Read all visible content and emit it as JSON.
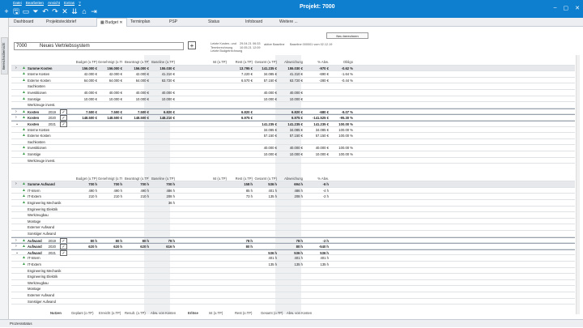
{
  "menu": [
    "Datei",
    "Bearbeiten",
    "Ansicht",
    "Extras",
    "?"
  ],
  "tools": [
    "+",
    "🖫",
    "▭",
    "⏷",
    "↶",
    "↷",
    "✕",
    "⇊",
    "⌂",
    "⇥"
  ],
  "window_title": "Projekt: 7000",
  "tabs": [
    "Dashboard",
    "Projektsteckbrief",
    "Budget",
    "Terminplan",
    "PSP",
    "Status",
    "Infoboard",
    "Weitere ..."
  ],
  "sidebar_label": "Bereichsübersicht",
  "header": {
    "project_id": "7000",
    "project_name": "Neues Vertriebssystem",
    "info_lines": [
      "Letzte Kosten- und Terminrechnung",
      "Letzte Budgetrechnung"
    ],
    "info_dates": [
      "29.04.21",
      "10.05.21"
    ],
    "info_times": [
      "06:33",
      "12:09"
    ],
    "aktive_label": "aktive Baseline",
    "aktive_value": "Baseline 000001 vom 02.12.19",
    "new_button": "Neu berechnen"
  },
  "cost_columns": [
    "Budget (o.TP)",
    "Genehmigt (o.TP)",
    "Beantragt (o.TP)",
    "Baseline (o.TP)",
    "Ist (o.TP)",
    "Rest (o.TP)",
    "Gesamt (o.TP)",
    "Abweichung",
    "% Abw.",
    "Obligo"
  ],
  "effort_columns": [
    "Budget (o.TP)",
    "Genehmigt (o.TP)",
    "Beantragt (o.TP)",
    "Baseline (o.TP)",
    "Ist (o.TP)",
    "Rest (o.TP)",
    "Gesamt (o.TP)",
    "Abweichung",
    "% Abw."
  ],
  "cost_rows": [
    {
      "kind": "sum",
      "label": "Summe Kosten",
      "v": [
        "156.000 €",
        "156.000 €",
        "156.000 €",
        "155.030 €",
        "",
        "13.795 €",
        "141.235 €",
        "155.030 €",
        "-970 €",
        "-0.62 %",
        ""
      ]
    },
    {
      "kind": "item",
      "label": "Interne Kosten",
      "v": [
        "42.000 €",
        "42.000 €",
        "42.000 €",
        "41.310 €",
        "",
        "7.220 €",
        "34.085 €",
        "41.310 €",
        "-690 €",
        "-1.64 %",
        ""
      ]
    },
    {
      "kind": "item",
      "label": "Externe Kosten",
      "v": [
        "64.000 €",
        "64.000 €",
        "64.000 €",
        "63.720 €",
        "",
        "6.570 €",
        "57.150 €",
        "63.720 €",
        "-280 €",
        "-0.44 %",
        ""
      ]
    },
    {
      "kind": "item",
      "label": "Sachkosten",
      "v": [
        "",
        "",
        "",
        "",
        "",
        "",
        "",
        "",
        "",
        "",
        ""
      ]
    },
    {
      "kind": "item",
      "label": "Investitionen",
      "v": [
        "40.000 €",
        "40.000 €",
        "40.000 €",
        "40.000 €",
        "",
        "",
        "40.000 €",
        "40.000 €",
        "",
        "",
        ""
      ]
    },
    {
      "kind": "item",
      "label": "Sonstige",
      "v": [
        "10.000 €",
        "10.000 €",
        "10.000 €",
        "10.000 €",
        "",
        "",
        "10.000 €",
        "10.000 €",
        "",
        "",
        ""
      ]
    },
    {
      "kind": "item",
      "label": "Werkzeuge invest.",
      "v": [
        "",
        "",
        "",
        "",
        "",
        "",
        "",
        "",
        "",
        "",
        ""
      ]
    },
    {
      "kind": "year",
      "label": "Kosten",
      "year": "2019",
      "v": [
        "7.500 €",
        "7.500 €",
        "7.500 €",
        "6.820 €",
        "",
        "6.820 €",
        "",
        "6.820 €",
        "-680 €",
        "-9.07 %",
        ""
      ]
    },
    {
      "kind": "year",
      "label": "Kosten",
      "year": "2020",
      "v": [
        "148.500 €",
        "148.500 €",
        "148.500 €",
        "148.210 €",
        "",
        "6.975 €",
        "",
        "6.975 €",
        "-141.525 €",
        "-95.30 %",
        ""
      ]
    },
    {
      "kind": "year",
      "label": "Kosten",
      "year": "2021",
      "v": [
        "",
        "",
        "",
        "",
        "",
        "",
        "141.235 €",
        "141.235 €",
        "141.235 €",
        "100.00 %",
        ""
      ]
    },
    {
      "kind": "item",
      "label": "Interne Kosten",
      "v": [
        "",
        "",
        "",
        "",
        "",
        "",
        "34.085 €",
        "34.085 €",
        "34.085 €",
        "100.00 %",
        ""
      ]
    },
    {
      "kind": "item",
      "label": "Externe Kosten",
      "v": [
        "",
        "",
        "",
        "",
        "",
        "",
        "57.150 €",
        "57.150 €",
        "57.150 €",
        "100.00 %",
        ""
      ]
    },
    {
      "kind": "item",
      "label": "Sachkosten",
      "v": [
        "",
        "",
        "",
        "",
        "",
        "",
        "",
        "",
        "",
        "",
        ""
      ]
    },
    {
      "kind": "item",
      "label": "Investitionen",
      "v": [
        "",
        "",
        "",
        "",
        "",
        "",
        "40.000 €",
        "40.000 €",
        "40.000 €",
        "100.00 %",
        ""
      ]
    },
    {
      "kind": "item",
      "label": "Sonstige",
      "v": [
        "",
        "",
        "",
        "",
        "",
        "",
        "10.000 €",
        "10.000 €",
        "10.000 €",
        "100.00 %",
        ""
      ]
    },
    {
      "kind": "item",
      "label": "Werkzeuge invest.",
      "v": [
        "",
        "",
        "",
        "",
        "",
        "",
        "",
        "",
        "",
        "",
        ""
      ]
    }
  ],
  "effort_rows": [
    {
      "kind": "sum",
      "label": "Summe Aufwand",
      "v": [
        "700 h",
        "700 h",
        "700 h",
        "700 h",
        "",
        "158 h",
        "536 h",
        "694 h",
        "-6 h",
        "-0.86 %"
      ]
    },
    {
      "kind": "item",
      "label": "IT-Intern",
      "v": [
        "490 h",
        "490 h",
        "490 h",
        "486 h",
        "",
        "85 h",
        "401 h",
        "486 h",
        "-4 h",
        "-0.82 %"
      ]
    },
    {
      "kind": "item",
      "label": "IT-Extern",
      "v": [
        "210 h",
        "210 h",
        "210 h",
        "208 h",
        "",
        "73 h",
        "135 h",
        "208 h",
        "-2 h",
        "-0.95 %"
      ]
    },
    {
      "kind": "item",
      "label": "Engineering Mechanik",
      "v": [
        "",
        "",
        "",
        "36 h",
        "",
        "",
        "",
        "",
        "",
        ""
      ]
    },
    {
      "kind": "item",
      "label": "Engineering Elektrik",
      "v": [
        "",
        "",
        "",
        "",
        "",
        "",
        "",
        "",
        "",
        ""
      ]
    },
    {
      "kind": "item",
      "label": "Werkzeugbau",
      "v": [
        "",
        "",
        "",
        "",
        "",
        "",
        "",
        "",
        "",
        ""
      ]
    },
    {
      "kind": "item",
      "label": "Montage",
      "v": [
        "",
        "",
        "",
        "",
        "",
        "",
        "",
        "",
        "",
        ""
      ]
    },
    {
      "kind": "item",
      "label": "Externer Aufwand",
      "v": [
        "",
        "",
        "",
        "",
        "",
        "",
        "",
        "",
        "",
        ""
      ]
    },
    {
      "kind": "item",
      "label": "Sonstiger Aufwand",
      "v": [
        "",
        "",
        "",
        "",
        "",
        "",
        "",
        "",
        "",
        ""
      ]
    },
    {
      "kind": "year",
      "label": "Aufwand",
      "year": "2019",
      "v": [
        "80 h",
        "80 h",
        "80 h",
        "78 h",
        "",
        "78 h",
        "",
        "78 h",
        "-2 h",
        "-2.50 %"
      ]
    },
    {
      "kind": "year",
      "label": "Aufwand",
      "year": "2020",
      "v": [
        "620 h",
        "620 h",
        "620 h",
        "616 h",
        "",
        "80 h",
        "",
        "80 h",
        "-540 h",
        "-87.10 %"
      ]
    },
    {
      "kind": "year",
      "label": "Aufwand",
      "year": "2021",
      "v": [
        "",
        "",
        "",
        "",
        "",
        "",
        "536 h",
        "536 h",
        "536 h",
        "100.00 %"
      ]
    },
    {
      "kind": "item",
      "label": "IT-Intern",
      "v": [
        "",
        "",
        "",
        "",
        "",
        "",
        "401 h",
        "401 h",
        "401 h",
        "100.00 %"
      ]
    },
    {
      "kind": "item",
      "label": "IT-Extern",
      "v": [
        "",
        "",
        "",
        "",
        "",
        "",
        "135 h",
        "135 h",
        "135 h",
        "100.00 %"
      ]
    },
    {
      "kind": "item",
      "label": "Engineering Mechanik",
      "v": [
        "",
        "",
        "",
        "",
        "",
        "",
        "",
        "",
        "",
        ""
      ]
    },
    {
      "kind": "item",
      "label": "Engineering Elektrik",
      "v": [
        "",
        "",
        "",
        "",
        "",
        "",
        "",
        "",
        "",
        ""
      ]
    },
    {
      "kind": "item",
      "label": "Werkzeugbau",
      "v": [
        "",
        "",
        "",
        "",
        "",
        "",
        "",
        "",
        "",
        ""
      ]
    },
    {
      "kind": "item",
      "label": "Montage",
      "v": [
        "",
        "",
        "",
        "",
        "",
        "",
        "",
        "",
        "",
        ""
      ]
    },
    {
      "kind": "item",
      "label": "Externer Aufwand",
      "v": [
        "",
        "",
        "",
        "",
        "",
        "",
        "",
        "",
        "",
        ""
      ]
    },
    {
      "kind": "item",
      "label": "Sonstiger Aufwand",
      "v": [
        "",
        "",
        "",
        "",
        "",
        "",
        "",
        "",
        "",
        ""
      ]
    }
  ],
  "footer": {
    "nutzen": "Nutzen",
    "cols1": [
      "Geplant (o.TP)",
      "Erreicht (o.TP)",
      "Result. (o.TP)",
      "Abw. von Kosten"
    ],
    "erloese": "Erlöse",
    "cols2": [
      "Ist (o.TP)",
      "Rest (o.TP)",
      "Gesamt (o.TP)",
      "Abw. von Kosten"
    ]
  },
  "status": "Prozessstatus"
}
